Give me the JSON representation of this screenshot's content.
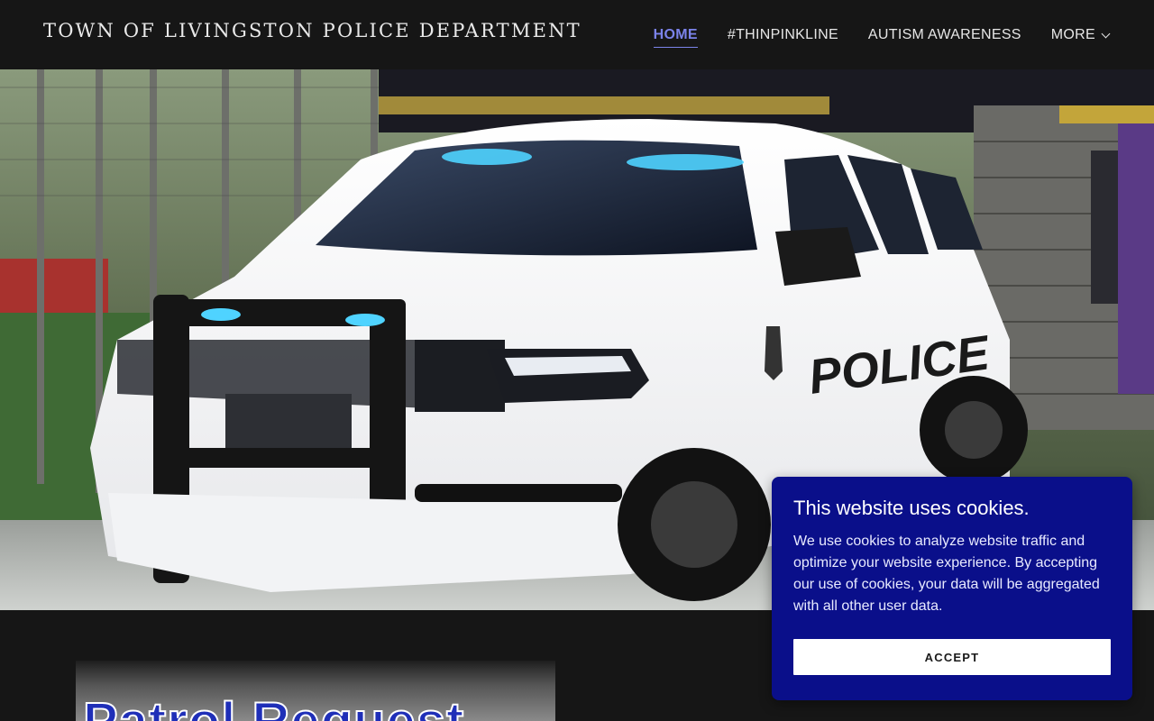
{
  "header": {
    "site_title": "TOWN OF LIVINGSTON POLICE DEPARTMENT",
    "nav": [
      {
        "label": "HOME",
        "active": true
      },
      {
        "label": "#THINPINKLINE",
        "active": false
      },
      {
        "label": "AUTISM AWARENESS",
        "active": false
      },
      {
        "label": "MORE",
        "active": false,
        "icon": "chevron-down-icon"
      }
    ]
  },
  "hero": {
    "image": "white police SUV with blue lights parked by a fence",
    "vehicle_text": "POLICE"
  },
  "promo": {
    "text": "Patrol Request"
  },
  "cookie_banner": {
    "title": "This website uses cookies.",
    "body": "We use cookies to analyze website traffic and optimize your website experience. By accepting our use of cookies, your data will be aggregated with all other user data.",
    "accept_label": "ACCEPT"
  },
  "colors": {
    "header_bg": "#161616",
    "nav_active": "#7b83ea",
    "cookie_bg": "#0a0f8a",
    "promo_text": "#1f2fb8"
  }
}
